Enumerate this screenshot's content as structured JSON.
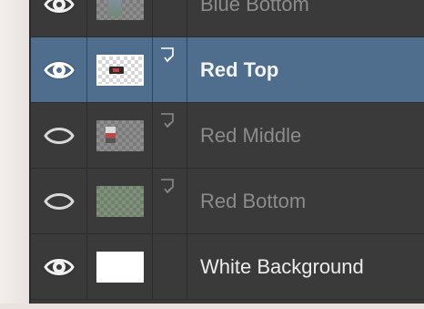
{
  "layers_panel": {
    "layers": [
      {
        "name": "Blue Bottom",
        "visible": true,
        "selected": false,
        "thumbnail": "figure-thumbnail",
        "clipping_mask": false
      },
      {
        "name": "Red Top",
        "visible": true,
        "selected": true,
        "thumbnail": "transparent-thumbnail-with-figure",
        "clipping_mask": true
      },
      {
        "name": "Red Middle",
        "visible": false,
        "selected": false,
        "thumbnail": "transparent-thumbnail-with-figure",
        "clipping_mask": true
      },
      {
        "name": "Red Bottom",
        "visible": false,
        "selected": false,
        "thumbnail": "green-texture-thumbnail",
        "clipping_mask": true
      },
      {
        "name": "White Background",
        "visible": true,
        "selected": false,
        "thumbnail": "white-thumbnail",
        "clipping_mask": false
      }
    ]
  },
  "colors": {
    "panel_background": "#3a3a3a",
    "selected_row": "#4f6e8e",
    "text_active": "#f3f3f3",
    "text_inactive": "#8c8c8c"
  },
  "icons": {
    "visibility": "eye-icon",
    "clipping_mask": "clipping-mask-icon"
  }
}
